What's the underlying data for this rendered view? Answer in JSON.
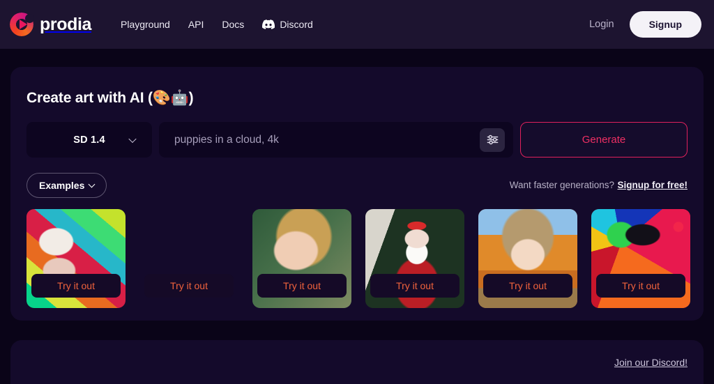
{
  "header": {
    "brand": "prodia",
    "logo_icon": "prodia-play-logo-icon",
    "nav": [
      {
        "label": "Playground",
        "icon": null
      },
      {
        "label": "API",
        "icon": null
      },
      {
        "label": "Docs",
        "icon": null
      },
      {
        "label": "Discord",
        "icon": "discord-icon"
      }
    ],
    "login_label": "Login",
    "signup_label": "Signup"
  },
  "main": {
    "title": "Create art with AI (🎨🤖)",
    "model_select": {
      "value": "SD 1.4",
      "caret_icon": "chevron-down-icon"
    },
    "prompt": {
      "value": "",
      "placeholder": "puppies in a cloud, 4k"
    },
    "settings_icon": "sliders-icon",
    "generate_label": "Generate",
    "examples_label": "Examples",
    "examples_caret_icon": "chevron-down-icon",
    "faster_text": "Want faster generations?",
    "faster_link": "Signup for free!",
    "try_label": "Try it out",
    "examples": [
      {
        "name": "colorful-painted-woman-portrait",
        "try_label": "Try it out"
      },
      {
        "name": "astronaut-on-horse-moon",
        "try_label": "Try it out"
      },
      {
        "name": "blonde-woman-portrait",
        "try_label": "Try it out"
      },
      {
        "name": "santa-claus-christmas-tree",
        "try_label": "Try it out"
      },
      {
        "name": "anime-girl-autumn",
        "try_label": "Try it out"
      },
      {
        "name": "psychedelic-mushroom-landscape",
        "try_label": "Try it out"
      }
    ]
  },
  "footer": {
    "discord_link": "Join our Discord!"
  },
  "colors": {
    "page_bg": "#0a0418",
    "header_bg": "#1d1430",
    "card_bg": "#140a2b",
    "input_bg": "#0d0520",
    "accent_pink": "#ef2f63",
    "accent_orange": "#f0623c",
    "signup_bg": "#f4f2f7"
  }
}
